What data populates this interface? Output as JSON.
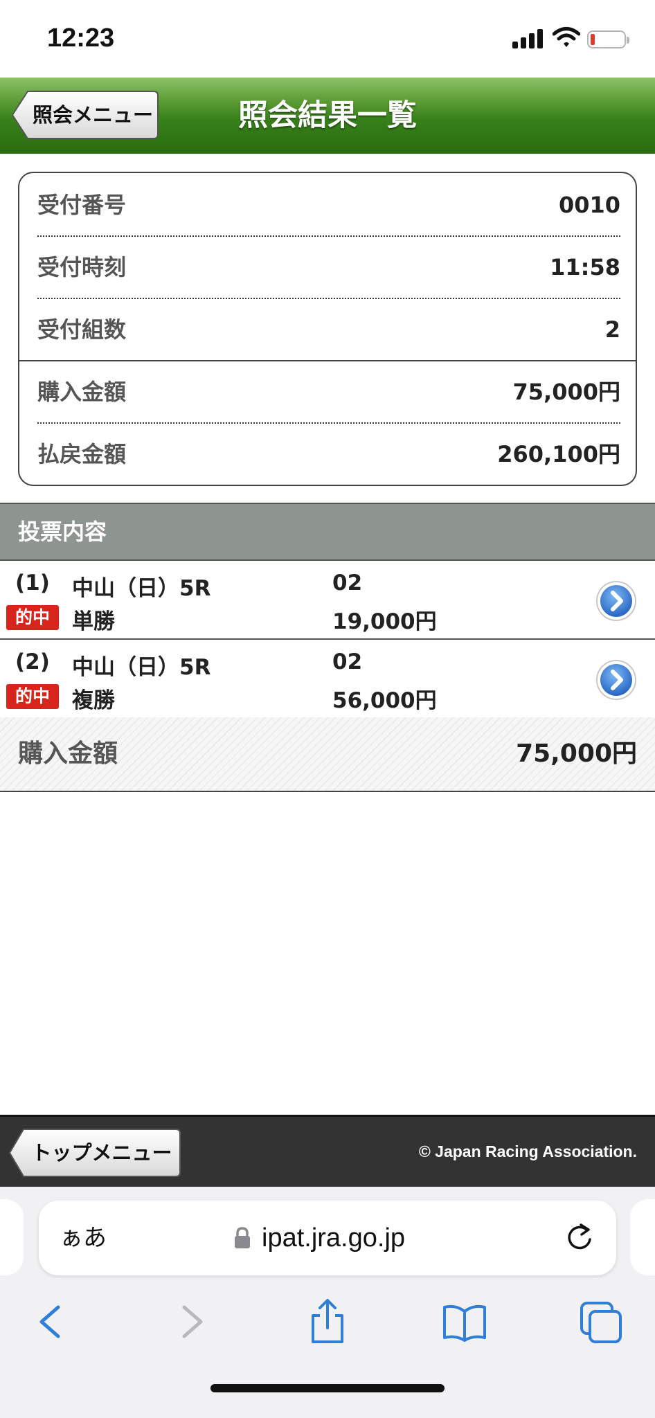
{
  "status_bar": {
    "time": "12:23"
  },
  "header": {
    "back_label": "照会メニュー",
    "title": "照会結果一覧"
  },
  "summary": {
    "rows": [
      {
        "label": "受付番号",
        "value": "0010"
      },
      {
        "label": "受付時刻",
        "value": "11:58"
      },
      {
        "label": "受付組数",
        "value": "2"
      },
      {
        "label": "購入金額",
        "value": "75,000円"
      },
      {
        "label": "払戻金額",
        "value": "260,100円"
      }
    ]
  },
  "section": {
    "title": "投票内容"
  },
  "bets": [
    {
      "num": "(1)",
      "hit_label": "的中",
      "venue": "中山（日）5R",
      "bet_type": "単勝",
      "horse": "02",
      "amount": "19,000円"
    },
    {
      "num": "(2)",
      "hit_label": "的中",
      "venue": "中山（日）5R",
      "bet_type": "複勝",
      "horse": "02",
      "amount": "56,000円"
    }
  ],
  "total": {
    "label": "購入金額",
    "value": "75,000円"
  },
  "footer": {
    "top_label": "トップメニュー",
    "copyright": "© Japan Racing Association."
  },
  "browser": {
    "text_size_label": "ぁあ",
    "url": "ipat.jra.go.jp"
  },
  "colors": {
    "header_green": "#37801a",
    "hit_red": "#d8251c",
    "section_gray": "#8e948f",
    "footer_dark": "#333333",
    "link_blue": "#2f7ed8"
  }
}
